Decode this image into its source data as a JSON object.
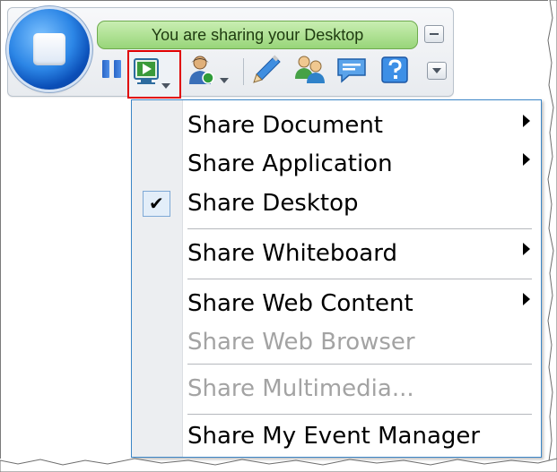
{
  "status": {
    "text": "You are sharing your Desktop"
  },
  "icons": {
    "stop": "stop-icon",
    "pause": "pause-icon",
    "share": "share-screen-icon",
    "participants": "participant-icon",
    "annotate": "pencil-icon",
    "attendees": "attendees-icon",
    "chat": "chat-icon",
    "help": "help-icon",
    "minimize": "minimize-icon",
    "more": "chevron-down-icon"
  },
  "menu": {
    "items": [
      {
        "label": "Share Document",
        "submenu": true,
        "enabled": true,
        "checked": false
      },
      {
        "label": "Share Application",
        "submenu": true,
        "enabled": true,
        "checked": false
      },
      {
        "label": "Share Desktop",
        "submenu": false,
        "enabled": true,
        "checked": true
      },
      {
        "label": "Share Whiteboard",
        "submenu": true,
        "enabled": true,
        "checked": false
      },
      {
        "label": "Share Web Content",
        "submenu": true,
        "enabled": true,
        "checked": false
      },
      {
        "label": "Share Web Browser",
        "submenu": false,
        "enabled": false,
        "checked": false
      },
      {
        "label": "Share Multimedia...",
        "submenu": false,
        "enabled": false,
        "checked": false
      },
      {
        "label": "Share My Event Manager",
        "submenu": false,
        "enabled": true,
        "checked": false
      }
    ],
    "check_mark": "✔"
  },
  "colors": {
    "status_green": "#98d579",
    "highlight_red": "#e00000",
    "menu_border": "#3c86c7",
    "disabled_text": "#a3a3a3"
  }
}
